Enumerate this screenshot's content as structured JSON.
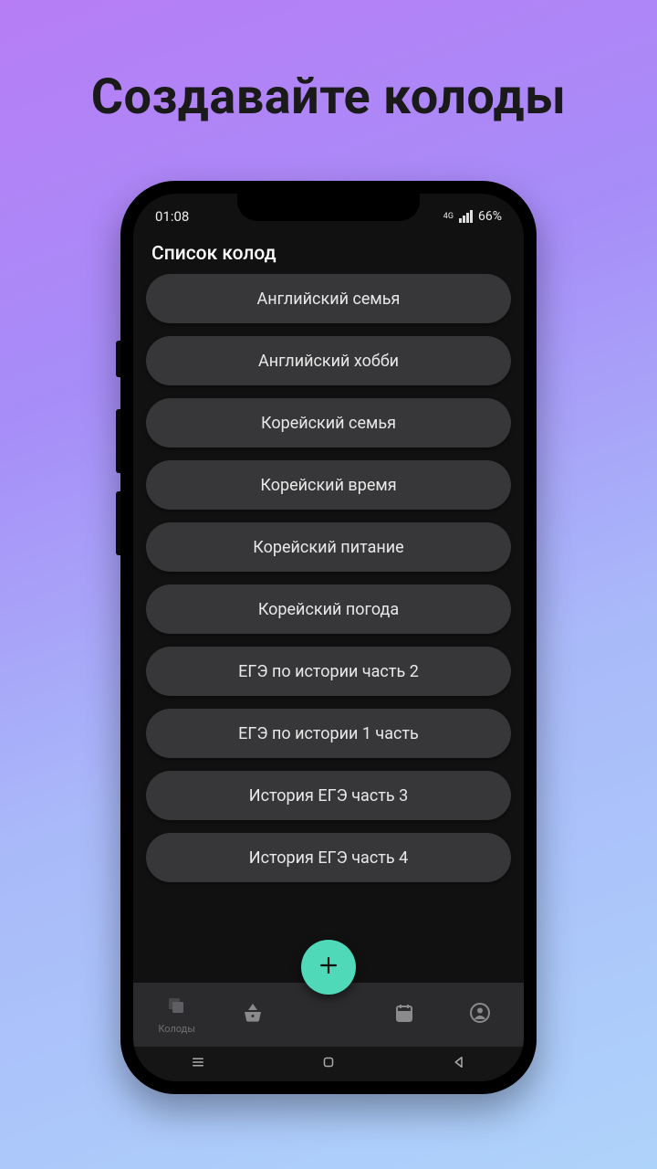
{
  "marketing": {
    "headline": "Создавайте колоды"
  },
  "statusbar": {
    "time": "01:08",
    "network": "4G",
    "battery": "66%"
  },
  "appbar": {
    "title": "Список колод"
  },
  "decks": [
    {
      "label": "Английский семья"
    },
    {
      "label": "Английский хобби"
    },
    {
      "label": "Корейский семья"
    },
    {
      "label": "Корейский время"
    },
    {
      "label": "Корейский питание"
    },
    {
      "label": "Корейский погода"
    },
    {
      "label": "ЕГЭ по истории часть 2"
    },
    {
      "label": "ЕГЭ по истории 1 часть"
    },
    {
      "label": "История ЕГЭ часть 3"
    },
    {
      "label": "История ЕГЭ часть 4"
    }
  ],
  "bottomnav": {
    "decks": "Колоды"
  }
}
